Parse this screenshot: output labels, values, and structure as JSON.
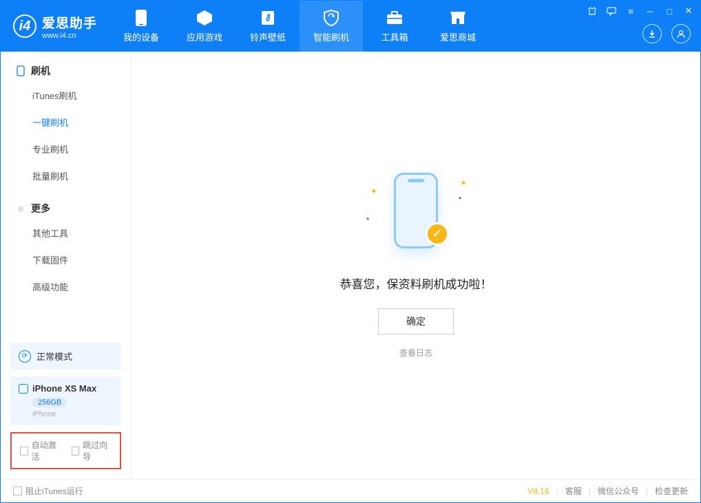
{
  "app": {
    "name": "爱思助手",
    "url": "www.i4.cn"
  },
  "nav": [
    {
      "label": "我的设备"
    },
    {
      "label": "应用游戏"
    },
    {
      "label": "铃声壁纸"
    },
    {
      "label": "智能刷机"
    },
    {
      "label": "工具箱"
    },
    {
      "label": "爱思商城"
    }
  ],
  "sidebar": {
    "section1": {
      "title": "刷机",
      "items": [
        "iTunes刷机",
        "一键刷机",
        "专业刷机",
        "批量刷机"
      ]
    },
    "section2": {
      "title": "更多",
      "items": [
        "其他工具",
        "下载固件",
        "高级功能"
      ]
    },
    "mode": "正常模式",
    "device": {
      "name": "iPhone XS Max",
      "storage": "256GB",
      "type": "iPhone"
    },
    "checkboxes": {
      "auto_activate": "自动激活",
      "skip_guide": "跳过向导"
    }
  },
  "main": {
    "success_message": "恭喜您，保资料刷机成功啦！",
    "confirm_button": "确定",
    "view_log": "查看日志"
  },
  "statusbar": {
    "block_itunes": "阻止iTunes运行",
    "version": "V8.16",
    "links": [
      "客服",
      "微信公众号",
      "检查更新"
    ]
  }
}
